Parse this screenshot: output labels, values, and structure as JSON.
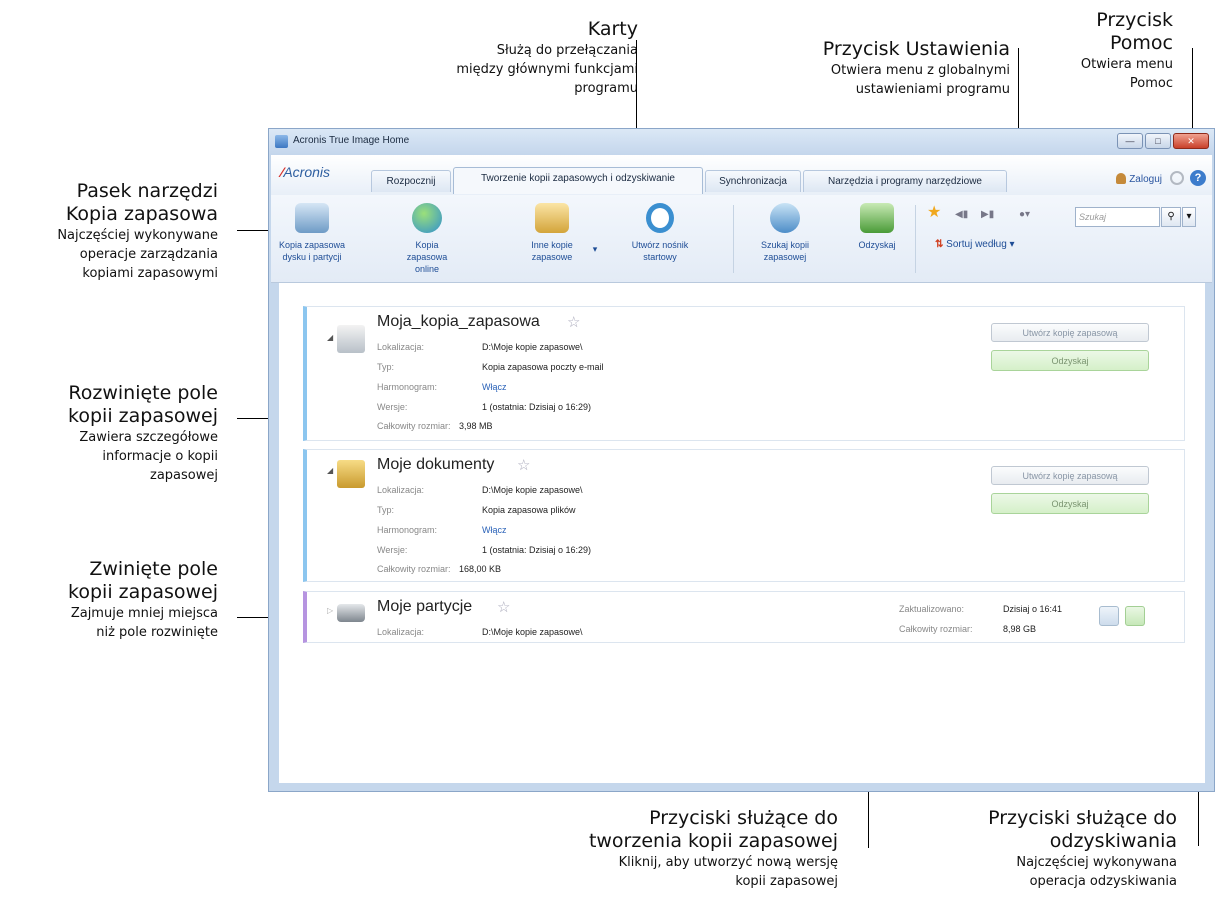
{
  "annotations": {
    "tabs": {
      "title": "Karty",
      "desc": [
        "Służą do przełączania",
        "między głównymi funkcjami",
        "programu"
      ]
    },
    "settings": {
      "title": "Przycisk Ustawienia",
      "desc": [
        "Otwiera menu z globalnymi",
        "ustawieniami programu"
      ]
    },
    "help": {
      "title": [
        "Przycisk",
        "Pomoc"
      ],
      "desc": [
        "Otwiera menu",
        "Pomoc"
      ]
    },
    "toolbar": {
      "title": [
        "Pasek narzędzi",
        "Kopia zapasowa"
      ],
      "desc": [
        "Najczęściej wykonywane",
        "operacje zarządzania",
        "kopiami zapasowymi"
      ]
    },
    "expanded": {
      "title": [
        "Rozwinięte pole",
        "kopii zapasowej"
      ],
      "desc": [
        "Zawiera szczegółowe",
        "informacje o kopii",
        "zapasowej"
      ]
    },
    "collapsed": {
      "title": [
        "Zwinięte pole",
        "kopii zapasowej"
      ],
      "desc": [
        "Zajmuje mniej miejsca",
        "niż pole rozwinięte"
      ]
    },
    "create_buttons": {
      "title": [
        "Przyciski służące do",
        "tworzenia kopii zapasowej"
      ],
      "desc": [
        "Kliknij, aby utworzyć nową wersję",
        "kopii zapasowej"
      ]
    },
    "restore_buttons": {
      "title": [
        "Przyciski służące do",
        "odzyskiwania"
      ],
      "desc": [
        "Najczęściej wykonywana",
        "operacja odzyskiwania"
      ]
    }
  },
  "window": {
    "title": "Acronis True Image Home",
    "logo": "Acronis",
    "tabs": [
      "Rozpocznij",
      "Tworzenie kopii zapasowych i odzyskiwanie",
      "Synchronizacja",
      "Narzędzia i programy narzędziowe"
    ],
    "login": "Zaloguj",
    "help_glyph": "?",
    "toolbar": {
      "disk_backup": [
        "Kopia zapasowa",
        "dysku i partycji"
      ],
      "online_backup": [
        "Kopia zapasowa",
        "online"
      ],
      "other_backups": [
        "Inne kopie",
        "zapasowe"
      ],
      "rescue_media": [
        "Utwórz nośnik",
        "startowy"
      ],
      "search_backup": [
        "Szukaj kopii",
        "zapasowej"
      ],
      "recover": "Odzyskaj",
      "sort": "Sortuj według",
      "search_placeholder": "Szukaj"
    }
  },
  "backups": [
    {
      "name": "Moja_kopia_zapasowa",
      "location_label": "Lokalizacja:",
      "location": "D:\\Moje kopie zapasowe\\",
      "type_label": "Typ:",
      "type": "Kopia zapasowa poczty e-mail",
      "schedule_label": "Harmonogram:",
      "schedule": "Włącz",
      "versions_label": "Wersje:",
      "versions": "1 (ostatnia: Dzisiaj o 16:29)",
      "size_label": "Całkowity rozmiar:",
      "size": "3,98 MB",
      "create_btn": "Utwórz kopię zapasową",
      "restore_btn": "Odzyskaj"
    },
    {
      "name": "Moje dokumenty",
      "location_label": "Lokalizacja:",
      "location": "D:\\Moje kopie zapasowe\\",
      "type_label": "Typ:",
      "type": "Kopia zapasowa plików",
      "schedule_label": "Harmonogram:",
      "schedule": "Włącz",
      "versions_label": "Wersje:",
      "versions": "1 (ostatnia: Dzisiaj o 16:29)",
      "size_label": "Całkowity rozmiar:",
      "size": "168,00 KB",
      "create_btn": "Utwórz kopię zapasową",
      "restore_btn": "Odzyskaj"
    },
    {
      "name": "Moje partycje",
      "location_label": "Lokalizacja:",
      "location": "D:\\Moje kopie zapasowe\\",
      "updated_label": "Zaktualizowano:",
      "updated": "Dzisiaj o 16:41",
      "size_label": "Całkowity rozmiar:",
      "size": "8,98 GB"
    }
  ]
}
